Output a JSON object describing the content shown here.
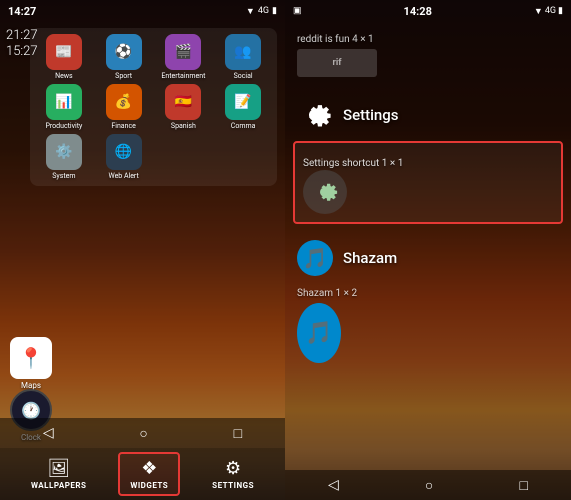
{
  "left": {
    "statusBar": {
      "time": "14:27",
      "signal": "4G",
      "battery": "▮"
    },
    "clockWidget": {
      "line1": "21:27",
      "line2": "15:27"
    },
    "appGrid": {
      "rows": [
        [
          {
            "label": "News",
            "color": "#c0392b",
            "icon": "📰"
          },
          {
            "label": "Sport",
            "color": "#2980b9",
            "icon": "⚽"
          },
          {
            "label": "Entertainment",
            "color": "#8e44ad",
            "icon": "🎬"
          },
          {
            "label": "Social",
            "color": "#3498db",
            "icon": "👥"
          }
        ],
        [
          {
            "label": "Productivity",
            "color": "#27ae60",
            "icon": "📊"
          },
          {
            "label": "Finance",
            "color": "#e67e22",
            "icon": "💰"
          },
          {
            "label": "Spanish",
            "color": "#e74c3c",
            "icon": "🇪🇸"
          },
          {
            "label": "Comma",
            "color": "#1abc9c",
            "icon": "📝"
          }
        ],
        [
          {
            "label": "System",
            "color": "#95a5a6",
            "icon": "⚙️"
          },
          {
            "label": "Web Alert",
            "color": "#2c3e50",
            "icon": "🌐"
          }
        ]
      ]
    },
    "bottomApps": {
      "maps": {
        "label": "Maps",
        "icon": "📍"
      },
      "clock": {
        "label": "Clock",
        "icon": "🕐"
      }
    },
    "dock": {
      "items": [
        {
          "label": "WALLPAPERS",
          "icon": "🖼",
          "active": false
        },
        {
          "label": "WIDGETS",
          "icon": "❖",
          "active": true
        },
        {
          "label": "SETTINGS",
          "icon": "⚙",
          "active": false
        }
      ]
    },
    "navBar": {
      "back": "◁",
      "home": "○",
      "recent": "□"
    }
  },
  "right": {
    "statusBar": {
      "photoIcon": "▣",
      "time": "14:28",
      "signal": "4G",
      "battery": "▮"
    },
    "sections": [
      {
        "id": "reddit",
        "appName": "reddit is fun",
        "iconColor": "#ff4500",
        "iconText": "rif",
        "widgets": [
          {
            "label": "reddit is fun 4 × 1",
            "previewWidth": 80
          }
        ]
      },
      {
        "id": "settings",
        "appName": "Settings",
        "widgets": [
          {
            "label": "Settings shortcut 1 × 1",
            "highlighted": true
          }
        ]
      },
      {
        "id": "shazam",
        "appName": "Shazam",
        "iconColor": "#0088cc",
        "widgets": [
          {
            "label": "Shazam 1 × 2"
          }
        ]
      }
    ],
    "navBar": {
      "back": "◁",
      "home": "○",
      "recent": "□"
    }
  }
}
